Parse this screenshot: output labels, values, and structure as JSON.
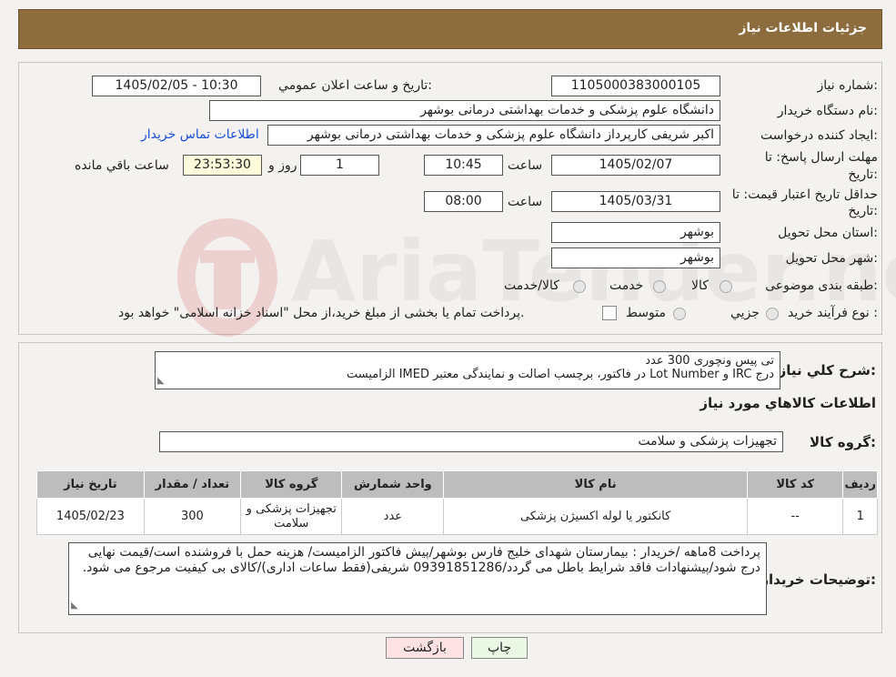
{
  "header": {
    "title": "جزئیات اطلاعات نیاز"
  },
  "watermark": {
    "text": "AriaTender.neT"
  },
  "form": {
    "need_number_label": "شماره نیاز:",
    "need_number": "1105000383000105",
    "announce_label": "تاریخ و ساعت اعلان عمومي:",
    "announce_value": "1405/02/05 - 10:30",
    "buyer_org_label": "نام دستگاه خريدار:",
    "buyer_org": "دانشگاه علوم پزشکی و خدمات بهداشتی درمانی بوشهر",
    "creator_label": "ايجاد کننده درخواست:",
    "creator": "اکبر شریفی کارپرداز دانشگاه علوم پزشکی و خدمات بهداشتی درمانی بوشهر",
    "contact_link": "اطلاعات تماس خريدار",
    "deadline_label_1": "مهلت ارسال پاسخ: تا",
    "deadline_label_2": "تاريخ:",
    "deadline_date": "1405/02/07",
    "time_label": "ساعت",
    "deadline_time": "10:45",
    "days_value": "1",
    "days_label": "روز و",
    "remaining_time": "23:53:30",
    "remaining_label": "ساعت باقي مانده",
    "validity_label_1": "حداقل تاريخ اعتبار قيمت: تا",
    "validity_label_2": "تاريخ:",
    "validity_date": "1405/03/31",
    "validity_time": "08:00",
    "province_label": "استان محل تحويل:",
    "province": "بوشهر",
    "city_label": "شهر محل تحويل:",
    "city": "بوشهر",
    "category_label": "طبقه بندی موضوعی:",
    "category_options": [
      "کالا",
      "خدمت",
      "کالا/خدمت"
    ],
    "purchase_type_label": "نوع فرآيند خريد :",
    "purchase_options": [
      "جزيي",
      "متوسط"
    ],
    "purchase_note": "پرداخت تمام يا بخشی از مبلغ خريد،از محل \"اسناد خزانه اسلامی\" خواهد بود."
  },
  "summary": {
    "label": "شرح کلي نياز:",
    "line1": "تی پیس ونچوری 300 عدد",
    "line2": "درج IRC و Lot Number در فاکتور، برچسب اصالت و نمایندگی معتبر IMED الزامیست"
  },
  "goods_info_title": "اطلاعات کالاهاي مورد نياز",
  "goods_group": {
    "label": "گروه کالا:",
    "value": "تجهیزات پزشکی و سلامت"
  },
  "table": {
    "headers": [
      "رديف",
      "کد کالا",
      "نام کالا",
      "واحد شمارش",
      "گروه کالا",
      "تعداد / مقدار",
      "تاريخ نياز"
    ],
    "rows": [
      [
        "1",
        "--",
        "کانکتور یا لوله اکسیژن پزشکی",
        "عدد",
        "تجهیزات پزشکی و سلامت",
        "300",
        "1405/02/23"
      ]
    ]
  },
  "buyer_notes": {
    "label": "توضيحات خريدار:",
    "text": "پرداخت 8ماهه /خریدار : بیمارستان شهدای خلیج فارس بوشهر/پیش فاکتور الزامیست/ هزینه حمل با فروشنده است/قیمت نهایی درج شود/پیشنهادات فاقد شرایط باطل می گردد/09391851286 شریفی(فقط ساعات اداری)/کالای بی کیفیت مرجوع می شود."
  },
  "buttons": {
    "print": "چاپ",
    "back": "بازگشت"
  },
  "colors": {
    "header": "#8d6c3d",
    "link": "#1a4fd6",
    "back_button": "#fde3e3",
    "print_button": "#eaf7e3",
    "table_header": "#bdbdbd"
  }
}
